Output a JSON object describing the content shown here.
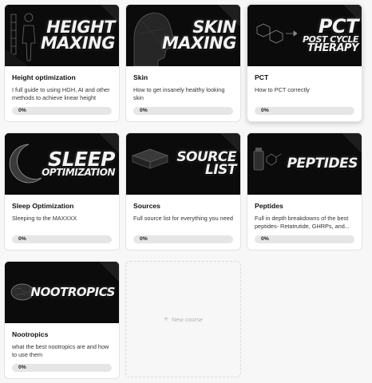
{
  "courses": [
    {
      "thumb_lines": [
        "HEIGHT",
        "MAXING"
      ],
      "title": "Height optimization",
      "description": "I full guide to using HGH, AI and other methods to achieve linear height growth",
      "progress": "0%"
    },
    {
      "thumb_lines": [
        "SKIN",
        "MAXING"
      ],
      "title": "Skin",
      "description": "How to get insanely healthy looking skin",
      "progress": "0%"
    },
    {
      "thumb_lines": [
        "PCT",
        "POST CYCLE",
        "THERAPY"
      ],
      "title": "PCT",
      "description": "How to PCT correctly",
      "progress": "0%"
    },
    {
      "thumb_lines": [
        "SLEEP",
        "OPTIMIZATION"
      ],
      "title": "Sleep Optimization",
      "description": "Sleeping to the MAXXXX",
      "progress": "0%"
    },
    {
      "thumb_lines": [
        "SOURCE",
        "LIST"
      ],
      "title": "Sources",
      "description": "Full source list for everything you need",
      "progress": "0%"
    },
    {
      "thumb_lines": [
        "PEPTIDES"
      ],
      "title": "Peptides",
      "description": "Full in depth breakdowns of the best peptides- Retatrutide, GHRPs, and...",
      "progress": "0%"
    },
    {
      "thumb_lines": [
        "NOOTROPICS"
      ],
      "title": "Nootropics",
      "description": "what the best nootropics are and how to use them",
      "progress": "0%"
    }
  ],
  "new_course": {
    "plus": "+",
    "label": "New course"
  },
  "colors": {
    "accent_bg": "#0b0b0b",
    "progress_track": "#e6e6e6",
    "page_bg": "#f7f7f7"
  }
}
